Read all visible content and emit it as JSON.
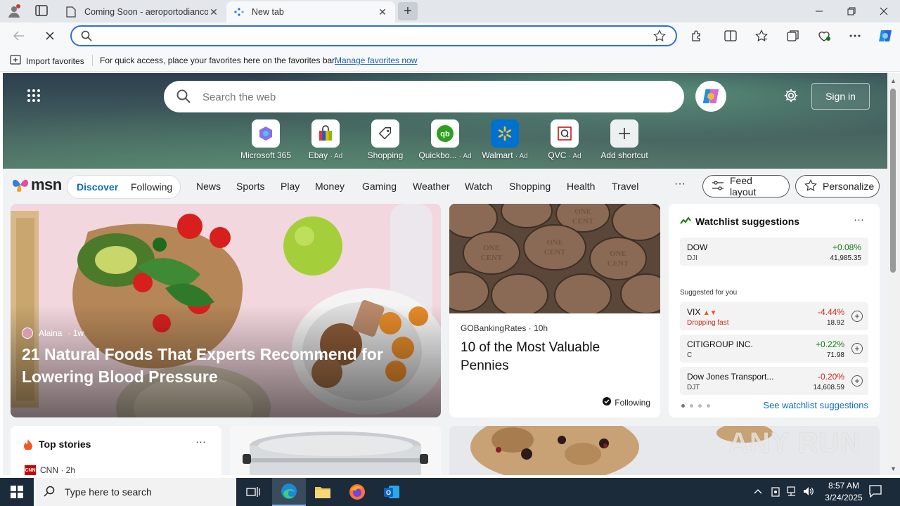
{
  "tabs": [
    {
      "label": "Coming Soon - aeroportodiancona.it"
    },
    {
      "label": "New tab"
    }
  ],
  "address_bar": {
    "value": "",
    "placeholder": ""
  },
  "favorites_bar": {
    "import_label": "Import favorites",
    "hint": "For quick access, place your favorites here on the favorites bar.",
    "manage_link": "Manage favorites now"
  },
  "hero": {
    "search_placeholder": "Search the web",
    "sign_in": "Sign in",
    "shortcuts": [
      {
        "label": "Microsoft 365",
        "ad": ""
      },
      {
        "label": "Ebay",
        "ad": "· Ad"
      },
      {
        "label": "Shopping",
        "ad": ""
      },
      {
        "label": "Quickbo...",
        "ad": "· Ad"
      },
      {
        "label": "Walmart",
        "ad": "· Ad"
      },
      {
        "label": "QVC",
        "ad": "· Ad"
      },
      {
        "label": "Add shortcut",
        "ad": ""
      }
    ]
  },
  "msn_nav": {
    "logo": "msn",
    "discover": "Discover",
    "following": "Following",
    "categories": [
      "News",
      "Sports",
      "Play",
      "Money",
      "Gaming",
      "Weather",
      "Watch",
      "Shopping",
      "Health",
      "Travel"
    ],
    "more": "···",
    "feed_layout": "Feed layout",
    "personalize": "Personalize"
  },
  "feature_story": {
    "author": "Alaina",
    "age": "· 1w",
    "headline": "21 Natural Foods That Experts Recommend for Lowering Blood Pressure"
  },
  "coin_story": {
    "source": "GOBankingRates",
    "age": "· 10h",
    "headline": "10 of the Most Valuable Pennies",
    "following": "Following"
  },
  "watchlist": {
    "title": "Watchlist suggestions",
    "more": "···",
    "primary": {
      "name": "DOW",
      "symbol": "DJI",
      "change": "+0.08%",
      "price": "41,985.35"
    },
    "suggested_label": "Suggested for you",
    "items": [
      {
        "name": "VIX",
        "symbol": "Dropping fast",
        "change": "-4.44%",
        "price": "18.92"
      },
      {
        "name": "CITIGROUP INC.",
        "symbol": "C",
        "change": "+0.22%",
        "price": "71.98"
      },
      {
        "name": "Dow Jones Transport...",
        "symbol": "DJT",
        "change": "-0.20%",
        "price": "14,608.59"
      }
    ],
    "see_all": "See watchlist suggestions"
  },
  "top_stories": {
    "title": "Top stories",
    "more": "···",
    "first_source": "CNN · 2h",
    "cnn_logo": "CNN"
  },
  "watermark": "ANY RUN",
  "taskbar": {
    "search_placeholder": "Type here to search",
    "time": "8:57 AM",
    "date": "3/24/2025"
  },
  "colors": {
    "accent": "#0f6cbd",
    "omnibox_border": "#2f6fd6",
    "positive": "#107c10",
    "negative": "#c42b1c",
    "taskbar": "#1c2b3a"
  }
}
